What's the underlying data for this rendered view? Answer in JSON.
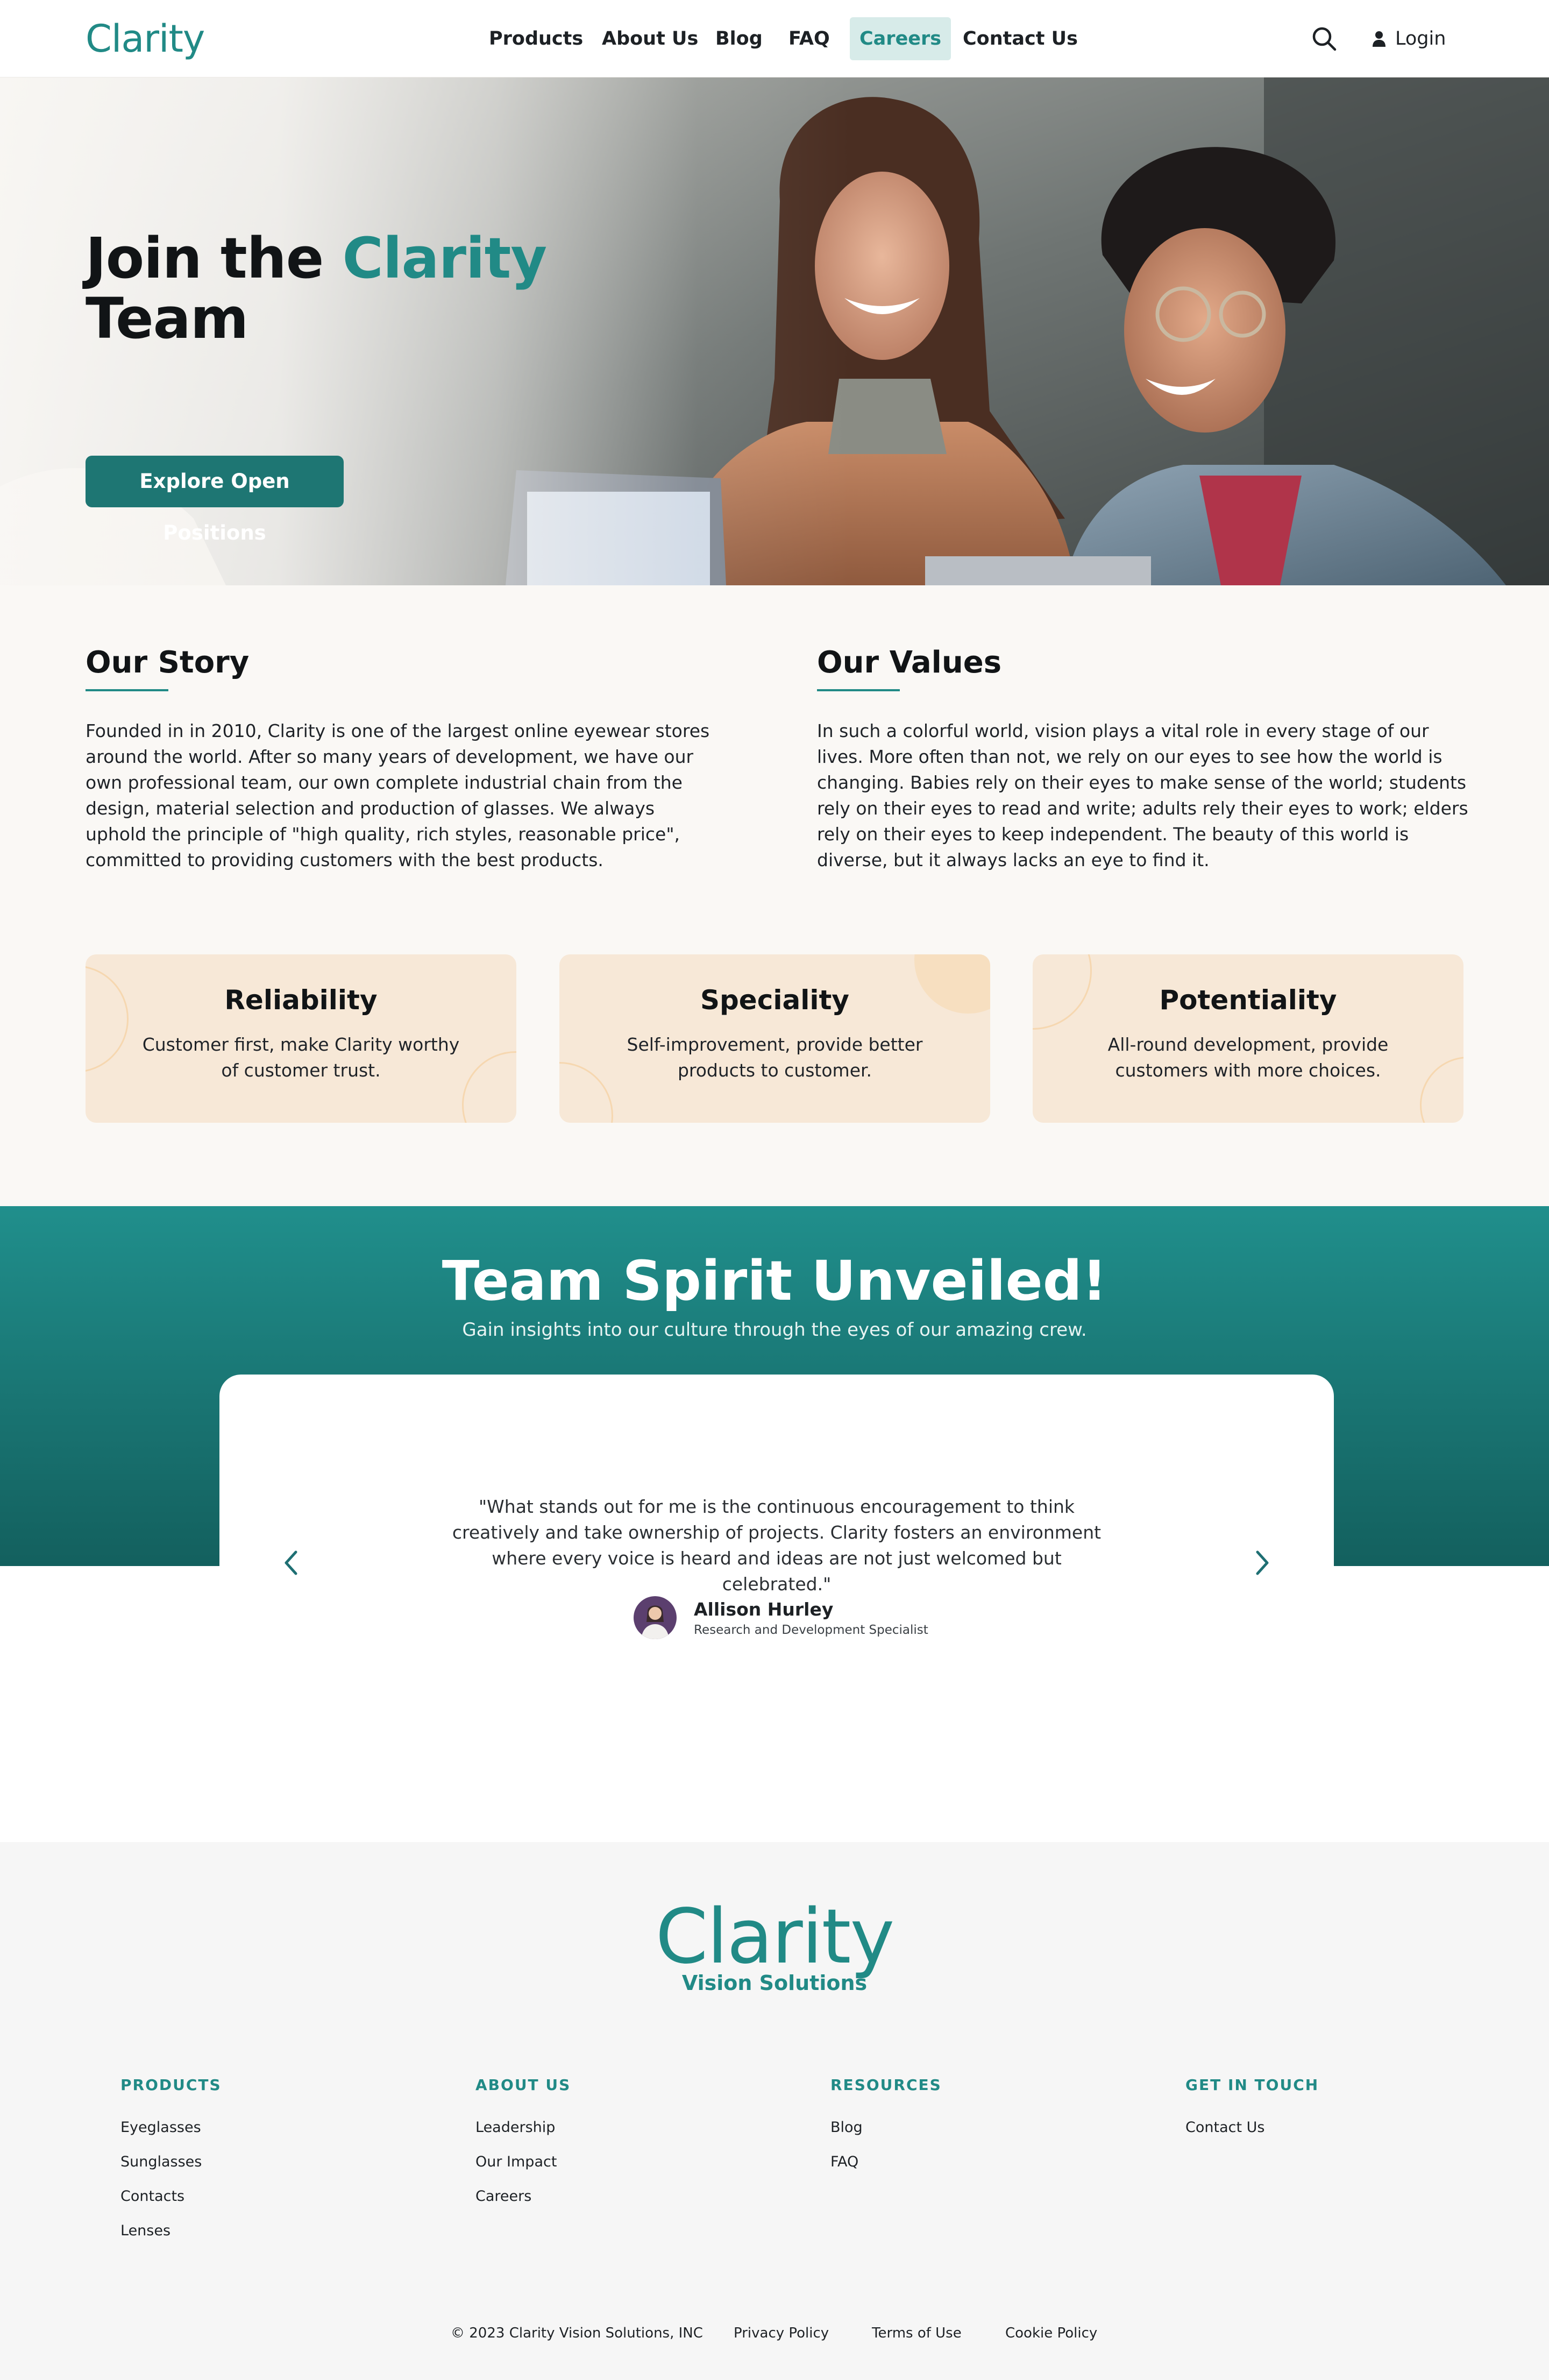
{
  "brand": {
    "name": "Clarity",
    "accent": "#218a86",
    "tagline": "Vision Solutions"
  },
  "nav": {
    "items": [
      {
        "label": "Products"
      },
      {
        "label": "About Us"
      },
      {
        "label": "Blog"
      },
      {
        "label": "FAQ"
      },
      {
        "label": "Careers",
        "active": true
      },
      {
        "label": "Contact Us"
      }
    ],
    "search_icon": "search-icon",
    "login_label": "Login",
    "login_icon": "user-icon"
  },
  "hero": {
    "title_prefix": "Join the",
    "title_accent": "Clarity",
    "title_suffix": "Team",
    "cta_label": "Explore Open Positions"
  },
  "story": {
    "title": "Our Story",
    "text": "Founded in in 2010, Clarity is one of the largest online eyewear stores around the world. After so many years of development, we have our own professional team, our own complete industrial chain from the design, material selection and production of glasses. We always uphold the principle of \"high quality, rich styles, reasonable price\", committed to providing customers with the best products."
  },
  "values": {
    "title": "Our Values",
    "text": "In such a colorful world, vision plays a vital role in every stage of our lives. More often than not, we rely on our eyes to see how the world is changing. Babies rely on their eyes to make sense of the world; students rely on their eyes to read and write; adults rely their eyes to work; elders rely on their eyes to keep independent. The beauty of this world is diverse, but it always lacks an eye to find it.",
    "cards": [
      {
        "title": "Reliability",
        "text": "Customer first, make Clarity worthy of customer trust."
      },
      {
        "title": "Speciality",
        "text": "Self-improvement, provide better products to customer."
      },
      {
        "title": "Potentiality",
        "text": "All-round development, provide customers with more choices."
      }
    ]
  },
  "team": {
    "title": "Team Spirit Unveiled!",
    "subtitle": "Gain insights into our culture through the eyes of our amazing crew.",
    "testimonial": {
      "quote": "\"What stands out for me is the continuous encouragement to think creatively and take ownership of projects. Clarity fosters an environment where every voice is heard and ideas are not just welcomed but celebrated.\"",
      "name": "Allison Hurley",
      "role": "Research and Development Specialist"
    },
    "prev_icon": "chevron-left-icon",
    "next_icon": "chevron-right-icon"
  },
  "footer": {
    "logo": "Clarity",
    "tagline": "Vision Solutions",
    "columns": [
      {
        "heading": "PRODUCTS",
        "links": [
          "Eyeglasses",
          "Sunglasses",
          "Contacts",
          "Lenses"
        ]
      },
      {
        "heading": "ABOUT US",
        "links": [
          "Leadership",
          "Our Impact",
          "Careers"
        ]
      },
      {
        "heading": "RESOURCES",
        "links": [
          "Blog",
          "FAQ"
        ]
      },
      {
        "heading": "GET IN TOUCH",
        "links": [
          "Contact Us"
        ]
      }
    ],
    "copyright": "© 2023 Clarity Vision Solutions, INC",
    "legal": [
      "Privacy Policy",
      "Terms of Use",
      "Cookie Policy"
    ]
  }
}
